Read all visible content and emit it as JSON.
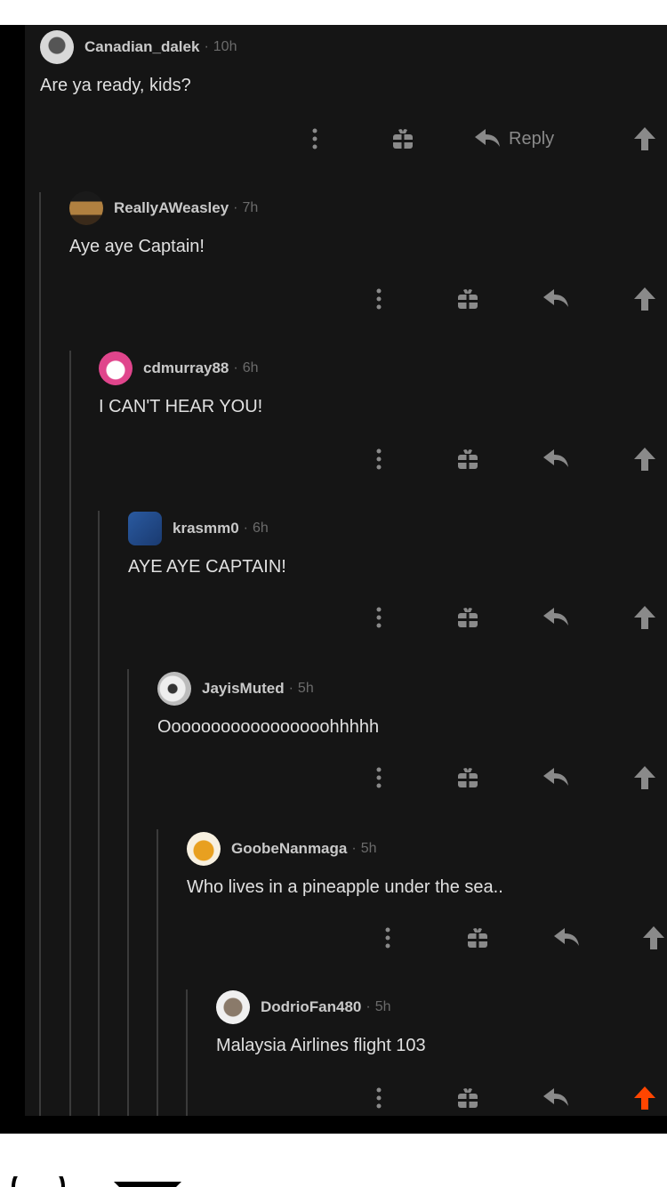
{
  "colors": {
    "background": "#151515",
    "text": "#e0e0e0",
    "username": "#c9c9c9",
    "muted": "#6b6b6b",
    "icon": "#8a8a8a",
    "upvote_active": "#ff4500"
  },
  "comments": [
    {
      "username": "Canadian_dalek",
      "separator": "·",
      "time": "10h",
      "text": "Are ya ready, kids?",
      "reply_label": "Reply"
    },
    {
      "username": "ReallyAWeasley",
      "separator": "·",
      "time": "7h",
      "text": "Aye aye Captain!"
    },
    {
      "username": "cdmurray88",
      "separator": "·",
      "time": "6h",
      "text": "I CAN'T HEAR YOU!"
    },
    {
      "username": "krasmm0",
      "separator": "·",
      "time": "6h",
      "text": "AYE AYE CAPTAIN!"
    },
    {
      "username": "JayisMuted",
      "separator": "·",
      "time": "5h",
      "text": "Ooooooooooooooooohhhhh"
    },
    {
      "username": "GoobeNanmaga",
      "separator": "·",
      "time": "5h",
      "text": "Who lives in a pineapple under the sea.."
    },
    {
      "username": "DodrioFan480",
      "separator": "·",
      "time": "5h",
      "text": "Malaysia Airlines flight 103",
      "upvoted": true
    }
  ],
  "icons": [
    "more-options-icon",
    "gift-icon",
    "reply-arrow-icon",
    "upvote-arrow-icon",
    "circle-icon",
    "filter-icon"
  ]
}
